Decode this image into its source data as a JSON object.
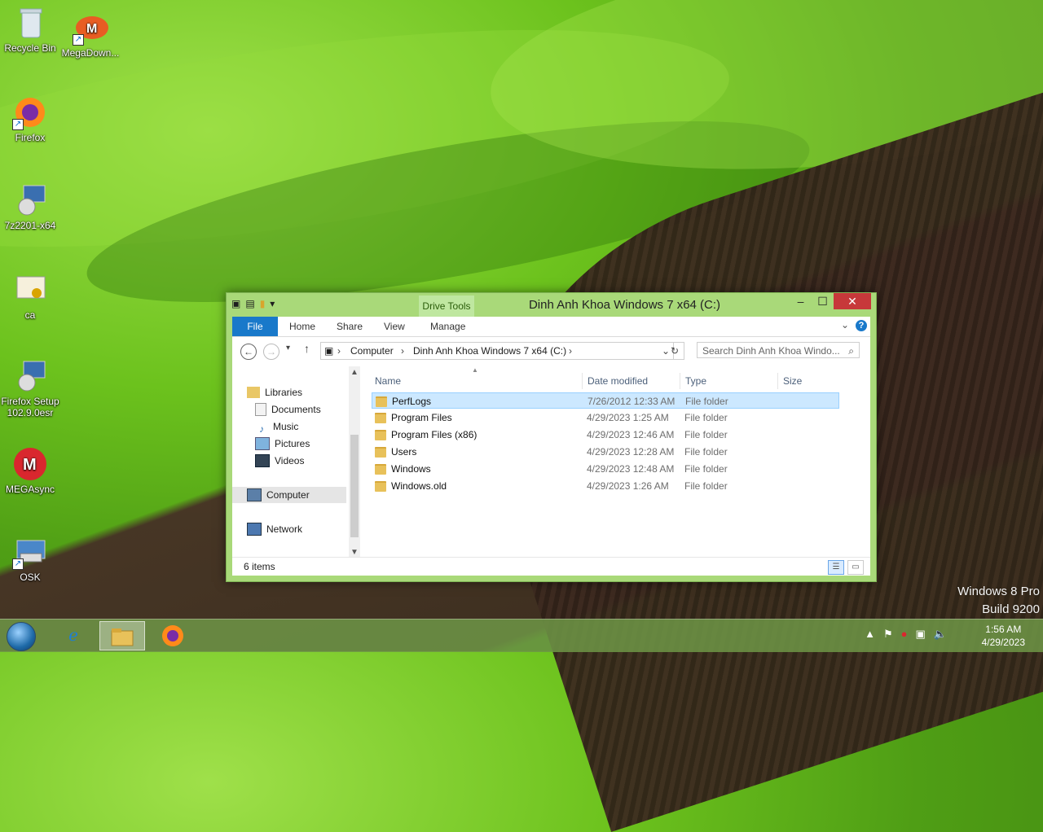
{
  "desktop": {
    "icons": [
      {
        "label": "Recycle Bin",
        "icon": "recycle-bin-icon"
      },
      {
        "label": "MegaDown...",
        "icon": "mega-downloader-icon"
      },
      {
        "label": "Firefox",
        "icon": "firefox-icon"
      },
      {
        "label": "7z2201-x64",
        "icon": "installer-icon"
      },
      {
        "label": "ca",
        "icon": "certificate-icon"
      },
      {
        "label": "Firefox Setup 102.9.0esr",
        "icon": "installer-icon"
      },
      {
        "label": "MEGAsync",
        "icon": "megasync-icon"
      },
      {
        "label": "OSK",
        "icon": "keyboard-icon"
      }
    ],
    "watermark_line1": "Windows 8 Pro",
    "watermark_line2": "Build 9200"
  },
  "window": {
    "title": "Dinh Anh Khoa Windows 7 x64 (C:)",
    "contextual_tab": "Drive Tools",
    "tabs": {
      "file": "File",
      "home": "Home",
      "share": "Share",
      "view": "View",
      "manage": "Manage"
    },
    "address": {
      "seg1": "Computer",
      "seg2": "Dinh Anh Khoa Windows 7 x64 (C:)"
    },
    "search_placeholder": "Search Dinh Anh Khoa Windo...",
    "nav": {
      "libraries": "Libraries",
      "documents": "Documents",
      "music": "Music",
      "pictures": "Pictures",
      "videos": "Videos",
      "computer": "Computer",
      "network": "Network"
    },
    "columns": {
      "name": "Name",
      "date": "Date modified",
      "type": "Type",
      "size": "Size"
    },
    "rows": [
      {
        "name": "PerfLogs",
        "date": "7/26/2012 12:33 AM",
        "type": "File folder"
      },
      {
        "name": "Program Files",
        "date": "4/29/2023 1:25 AM",
        "type": "File folder"
      },
      {
        "name": "Program Files (x86)",
        "date": "4/29/2023 12:46 AM",
        "type": "File folder"
      },
      {
        "name": "Users",
        "date": "4/29/2023 12:28 AM",
        "type": "File folder"
      },
      {
        "name": "Windows",
        "date": "4/29/2023 12:48 AM",
        "type": "File folder"
      },
      {
        "name": "Windows.old",
        "date": "4/29/2023 1:26 AM",
        "type": "File folder"
      }
    ],
    "status": "6 items"
  },
  "taskbar": {
    "clock_time": "1:56 AM",
    "clock_date": "4/29/2023"
  }
}
